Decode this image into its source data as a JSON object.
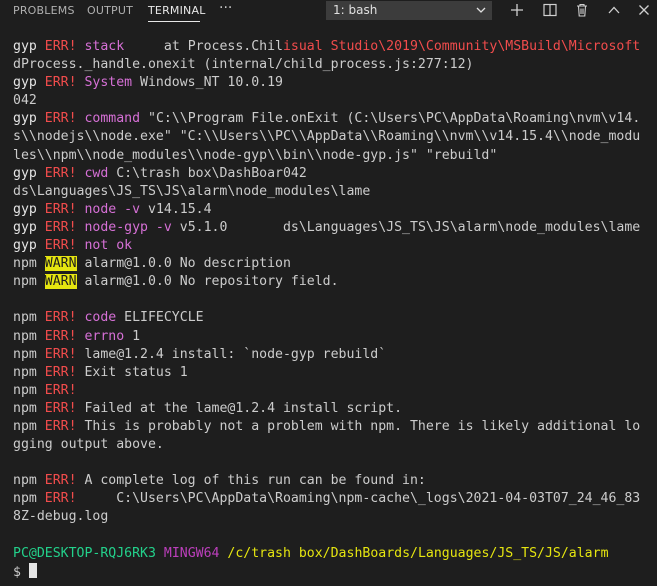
{
  "header": {
    "tabs": [
      "PROBLEMS",
      "OUTPUT",
      "TERMINAL"
    ],
    "active_tab": "TERMINAL",
    "more_label": "···",
    "shell_selected": "1: bash"
  },
  "terminal": {
    "lines": [
      [
        {
          "t": "gyp ",
          "c": "gyp"
        },
        {
          "t": "ERR!",
          "c": "err"
        },
        {
          "t": " stack     ",
          "c": "mag"
        },
        {
          "t": "at Process.Chil",
          "c": ""
        },
        {
          "t": "isual Studio\\2019\\Community\\MSBuild\\Microsoft",
          "c": "err"
        }
      ],
      [
        {
          "t": "dProcess._handle.onexit (internal/child_process.js:277:12)",
          "c": ""
        }
      ],
      [
        {
          "t": "gyp ",
          "c": "gyp"
        },
        {
          "t": "ERR!",
          "c": "err"
        },
        {
          "t": " System",
          "c": "mag"
        },
        {
          "t": " Windows_NT 10.0.19",
          "c": ""
        }
      ],
      [
        {
          "t": "042",
          "c": ""
        }
      ],
      [
        {
          "t": "gyp ",
          "c": "gyp"
        },
        {
          "t": "ERR!",
          "c": "err"
        },
        {
          "t": " command",
          "c": "mag"
        },
        {
          "t": " \"C:\\\\Program File.onExit (C:\\Users\\PC\\AppData\\Roaming\\nvm\\v14.",
          "c": ""
        }
      ],
      [
        {
          "t": "s\\\\nodejs\\\\node.exe\" \"C:\\\\Users\\\\PC\\\\AppData\\\\Roaming\\\\nvm\\\\v14.15.4\\\\node_modu",
          "c": ""
        }
      ],
      [
        {
          "t": "les\\\\npm\\\\node_modules\\\\node-gyp\\\\bin\\\\node-gyp.js\" \"rebuild\"",
          "c": ""
        }
      ],
      [
        {
          "t": "gyp ",
          "c": "gyp"
        },
        {
          "t": "ERR!",
          "c": "err"
        },
        {
          "t": " cwd",
          "c": "mag"
        },
        {
          "t": " C:\\trash box\\DashBoar042",
          "c": ""
        }
      ],
      [
        {
          "t": "ds\\Languages\\JS_TS\\JS\\alarm\\node_modules\\lame",
          "c": ""
        }
      ],
      [
        {
          "t": "gyp ",
          "c": "gyp"
        },
        {
          "t": "ERR!",
          "c": "err"
        },
        {
          "t": " node -v",
          "c": "mag"
        },
        {
          "t": " v14.15.4",
          "c": ""
        }
      ],
      [
        {
          "t": "gyp ",
          "c": "gyp"
        },
        {
          "t": "ERR!",
          "c": "err"
        },
        {
          "t": " node-gyp -v",
          "c": "mag"
        },
        {
          "t": " v5.1.0       ds\\Languages\\JS_TS\\JS\\alarm\\node_modules\\lame",
          "c": ""
        }
      ],
      [
        {
          "t": "gyp ",
          "c": "gyp"
        },
        {
          "t": "ERR!",
          "c": "err"
        },
        {
          "t": " not ok",
          "c": "mag"
        }
      ],
      [
        {
          "t": "npm ",
          "c": ""
        },
        {
          "t": "WARN",
          "c": "warnbg"
        },
        {
          "t": " alarm@1.0.0 No description",
          "c": ""
        }
      ],
      [
        {
          "t": "npm ",
          "c": ""
        },
        {
          "t": "WARN",
          "c": "warnbg"
        },
        {
          "t": " alarm@1.0.0 No repository field.",
          "c": ""
        }
      ],
      [
        {
          "t": "",
          "c": ""
        }
      ],
      [
        {
          "t": "npm ",
          "c": ""
        },
        {
          "t": "ERR!",
          "c": "err"
        },
        {
          "t": " code",
          "c": "mag"
        },
        {
          "t": " ELIFECYCLE",
          "c": ""
        }
      ],
      [
        {
          "t": "npm ",
          "c": ""
        },
        {
          "t": "ERR!",
          "c": "err"
        },
        {
          "t": " errno",
          "c": "mag"
        },
        {
          "t": " 1",
          "c": ""
        }
      ],
      [
        {
          "t": "npm ",
          "c": ""
        },
        {
          "t": "ERR!",
          "c": "err"
        },
        {
          "t": " lame@1.2.4 install: `node-gyp rebuild`",
          "c": ""
        }
      ],
      [
        {
          "t": "npm ",
          "c": ""
        },
        {
          "t": "ERR!",
          "c": "err"
        },
        {
          "t": " Exit status 1",
          "c": ""
        }
      ],
      [
        {
          "t": "npm ",
          "c": ""
        },
        {
          "t": "ERR!",
          "c": "err"
        }
      ],
      [
        {
          "t": "npm ",
          "c": ""
        },
        {
          "t": "ERR!",
          "c": "err"
        },
        {
          "t": " Failed at the lame@1.2.4 install script.",
          "c": ""
        }
      ],
      [
        {
          "t": "npm ",
          "c": ""
        },
        {
          "t": "ERR!",
          "c": "err"
        },
        {
          "t": " This is probably not a problem with npm. There is likely additional lo",
          "c": ""
        }
      ],
      [
        {
          "t": "gging output above.",
          "c": ""
        }
      ],
      [
        {
          "t": "",
          "c": ""
        }
      ],
      [
        {
          "t": "npm ",
          "c": ""
        },
        {
          "t": "ERR!",
          "c": "err"
        },
        {
          "t": " A complete log of this run can be found in:",
          "c": ""
        }
      ],
      [
        {
          "t": "npm ",
          "c": ""
        },
        {
          "t": "ERR!",
          "c": "err"
        },
        {
          "t": "     C:\\Users\\PC\\AppData\\Roaming\\npm-cache\\_logs\\2021-04-03T07_24_46_83",
          "c": ""
        }
      ],
      [
        {
          "t": "8Z-debug.log",
          "c": ""
        }
      ],
      [
        {
          "t": "",
          "c": ""
        }
      ],
      [
        {
          "t": "PC@DESKTOP-RQJ6RK3",
          "c": "green"
        },
        {
          "t": " ",
          "c": ""
        },
        {
          "t": "MINGW64",
          "c": "purple"
        },
        {
          "t": " ",
          "c": ""
        },
        {
          "t": "/c/trash box/DashBoards/Languages/JS_TS/JS/alarm",
          "c": "yellow"
        }
      ],
      [
        {
          "t": "$ ",
          "c": ""
        }
      ]
    ]
  }
}
